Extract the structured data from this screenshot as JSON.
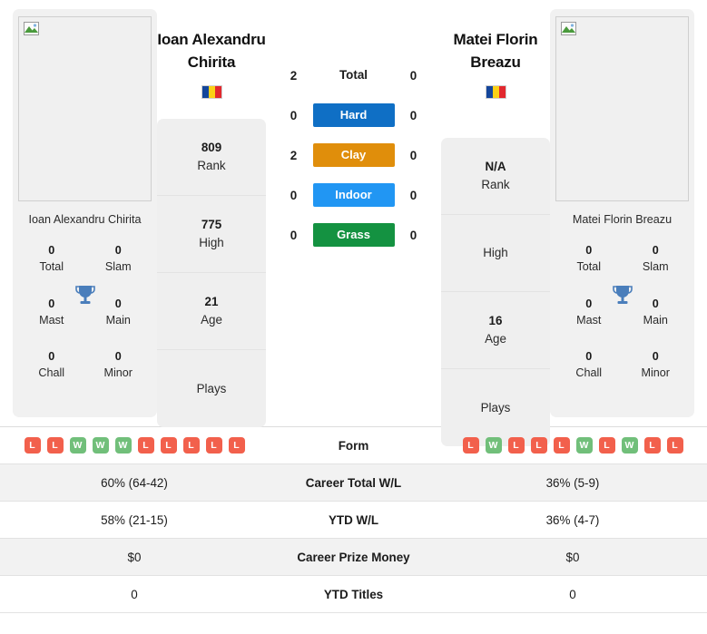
{
  "players": {
    "left": {
      "name_line1": "Ioan Alexandru",
      "name_line2": "Chirita",
      "photo_caption": "Ioan Alexandru Chirita",
      "flag": "Romania",
      "rank": "809",
      "rank_label": "Rank",
      "high": "775",
      "high_label": "High",
      "age": "21",
      "age_label": "Age",
      "plays": "",
      "plays_label": "Plays",
      "titles": [
        {
          "value": "0",
          "label": "Total"
        },
        {
          "value": "0",
          "label": "Slam"
        },
        {
          "value": "0",
          "label": "Mast"
        },
        {
          "value": "0",
          "label": "Main"
        },
        {
          "value": "0",
          "label": "Chall"
        },
        {
          "value": "0",
          "label": "Minor"
        }
      ],
      "form": [
        "L",
        "L",
        "W",
        "W",
        "W",
        "L",
        "L",
        "L",
        "L",
        "L"
      ],
      "career_wl": "60% (64-42)",
      "ytd_wl": "58% (21-15)",
      "career_prize": "$0",
      "ytd_titles": "0"
    },
    "right": {
      "name_line1": "Matei Florin",
      "name_line2": "Breazu",
      "photo_caption": "Matei Florin Breazu",
      "flag": "Romania",
      "rank": "N/A",
      "rank_label": "Rank",
      "high": "",
      "high_label": "High",
      "age": "16",
      "age_label": "Age",
      "plays": "",
      "plays_label": "Plays",
      "titles": [
        {
          "value": "0",
          "label": "Total"
        },
        {
          "value": "0",
          "label": "Slam"
        },
        {
          "value": "0",
          "label": "Mast"
        },
        {
          "value": "0",
          "label": "Main"
        },
        {
          "value": "0",
          "label": "Chall"
        },
        {
          "value": "0",
          "label": "Minor"
        }
      ],
      "form": [
        "L",
        "W",
        "L",
        "L",
        "L",
        "W",
        "L",
        "W",
        "L",
        "L"
      ],
      "career_wl": "36% (5-9)",
      "ytd_wl": "36% (4-7)",
      "career_prize": "$0",
      "ytd_titles": "0"
    }
  },
  "surfaces": [
    {
      "label": "Total",
      "left": "2",
      "right": "0",
      "color": "none"
    },
    {
      "label": "Hard",
      "left": "0",
      "right": "0",
      "color": "#0f6fc5"
    },
    {
      "label": "Clay",
      "left": "2",
      "right": "0",
      "color": "#e08e0b"
    },
    {
      "label": "Indoor",
      "left": "0",
      "right": "0",
      "color": "#2196f3"
    },
    {
      "label": "Grass",
      "left": "0",
      "right": "0",
      "color": "#149241"
    }
  ],
  "stats_rows": [
    {
      "label": "Form",
      "left": "",
      "right": ""
    },
    {
      "label": "Career Total W/L",
      "left": "60% (64-42)",
      "right": "36% (5-9)"
    },
    {
      "label": "YTD W/L",
      "left": "58% (21-15)",
      "right": "36% (4-7)"
    },
    {
      "label": "Career Prize Money",
      "left": "$0",
      "right": "$0"
    },
    {
      "label": "YTD Titles",
      "left": "0",
      "right": "0"
    }
  ],
  "colors": {
    "win": "#71bf7a",
    "loss": "#f2604c",
    "trophy": "#4a7ebb",
    "card_bg": "#efefef",
    "flag_blue": "#14469b",
    "flag_yellow": "#fbd116",
    "flag_red": "#e2282e"
  }
}
